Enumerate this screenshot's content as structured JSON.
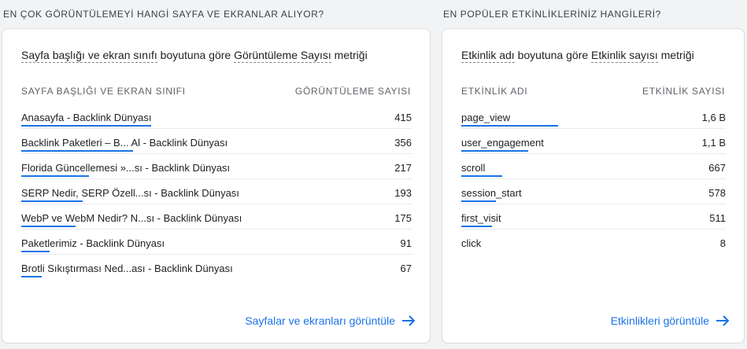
{
  "left": {
    "section_title": "EN ÇOK GÖRÜNTÜLEMEYİ HANGİ SAYFA VE EKRANLAR ALIYOR?",
    "subtitle_prefix": "Sayfa başlığı ve ekran sınıfı",
    "subtitle_mid": " boyutuna göre ",
    "subtitle_metric": "Görüntüleme Sayısı",
    "subtitle_suffix": " metriği",
    "col_name": "SAYFA BAŞLIĞI VE EKRAN SINIFI",
    "col_value": "GÖRÜNTÜLEME SAYISI",
    "rows": [
      {
        "label": "Anasayfa - Backlink Dünyası",
        "value": "415",
        "bar_fraction": 1.0
      },
      {
        "label": "Backlink Paketleri – B... Al - Backlink Dünyası",
        "value": "356",
        "bar_fraction": 0.86
      },
      {
        "label": "Florida Güncellemesi »...sı - Backlink Dünyası",
        "value": "217",
        "bar_fraction": 0.52
      },
      {
        "label": "SERP Nedir, SERP Özell...sı - Backlink Dünyası",
        "value": "193",
        "bar_fraction": 0.47
      },
      {
        "label": "WebP ve WebM Nedir? N...sı - Backlink Dünyası",
        "value": "175",
        "bar_fraction": 0.42
      },
      {
        "label": "Paketlerimiz - Backlink Dünyası",
        "value": "91",
        "bar_fraction": 0.22
      },
      {
        "label": "Brotli Sıkıştırması Ned...ası - Backlink Dünyası",
        "value": "67",
        "bar_fraction": 0.16
      }
    ],
    "link_label": "Sayfalar ve ekranları görüntüle"
  },
  "right": {
    "section_title": "EN POPÜLER ETKİNLİKLERİNİZ HANGİLERİ?",
    "subtitle_prefix": "Etkinlik adı",
    "subtitle_mid": " boyutuna göre ",
    "subtitle_metric": "Etkinlik sayısı",
    "subtitle_suffix": " metriği",
    "col_name": "ETKİNLİK ADI",
    "col_value": "ETKİNLİK SAYISI",
    "rows": [
      {
        "label": "page_view",
        "value": "1,6 B",
        "bar_fraction": 1.0
      },
      {
        "label": "user_engagement",
        "value": "1,1 B",
        "bar_fraction": 0.69
      },
      {
        "label": "scroll",
        "value": "667",
        "bar_fraction": 0.42
      },
      {
        "label": "session_start",
        "value": "578",
        "bar_fraction": 0.36
      },
      {
        "label": "first_visit",
        "value": "511",
        "bar_fraction": 0.32
      },
      {
        "label": "click",
        "value": "8",
        "bar_fraction": 0.0
      }
    ],
    "link_label": "Etkinlikleri görüntüle"
  },
  "colors": {
    "accent": "#1a73e8"
  },
  "icons": {
    "link_arrow": "arrow-right-icon"
  }
}
